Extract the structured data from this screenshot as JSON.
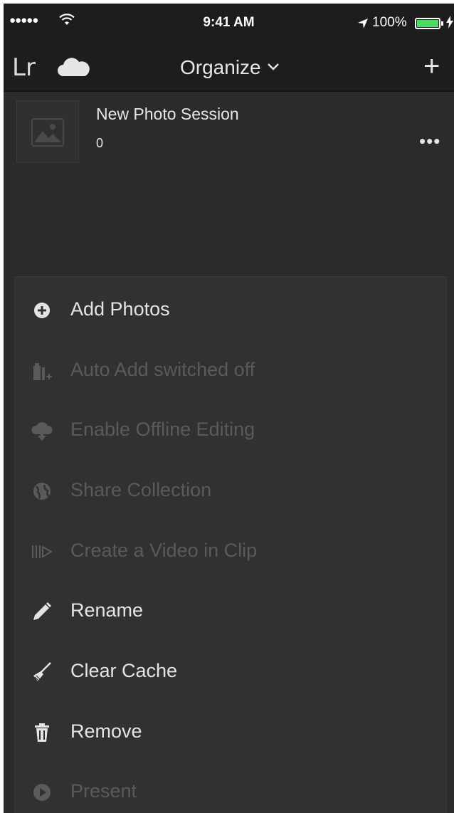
{
  "status_bar": {
    "signal": "●●●●●",
    "time": "9:41 AM",
    "battery_percent": "100%"
  },
  "nav": {
    "app_logo": "Lr",
    "title": "Organize",
    "add_label": "+"
  },
  "collection": {
    "name": "New Photo Session",
    "count": "0",
    "more_label": "•••"
  },
  "menu": {
    "items": [
      {
        "label": "Add Photos",
        "icon": "plus-circle-icon",
        "enabled": true
      },
      {
        "label": "Auto Add switched off",
        "icon": "auto-add-icon",
        "enabled": false
      },
      {
        "label": "Enable Offline Editing",
        "icon": "cloud-download-icon",
        "enabled": false
      },
      {
        "label": "Share Collection",
        "icon": "globe-icon",
        "enabled": false
      },
      {
        "label": "Create a Video in Clip",
        "icon": "video-clip-icon",
        "enabled": false
      },
      {
        "label": "Rename",
        "icon": "pencil-icon",
        "enabled": true
      },
      {
        "label": "Clear Cache",
        "icon": "broom-icon",
        "enabled": true
      },
      {
        "label": "Remove",
        "icon": "trash-icon",
        "enabled": true
      },
      {
        "label": "Present",
        "icon": "play-circle-icon",
        "enabled": false
      }
    ]
  },
  "colors": {
    "background": "#2b2b2c",
    "bar": "#1d1d1e",
    "sheet": "#313132",
    "text": "#e4e4e4",
    "disabled_text": "#5a5a5b",
    "battery": "#4cd964"
  }
}
